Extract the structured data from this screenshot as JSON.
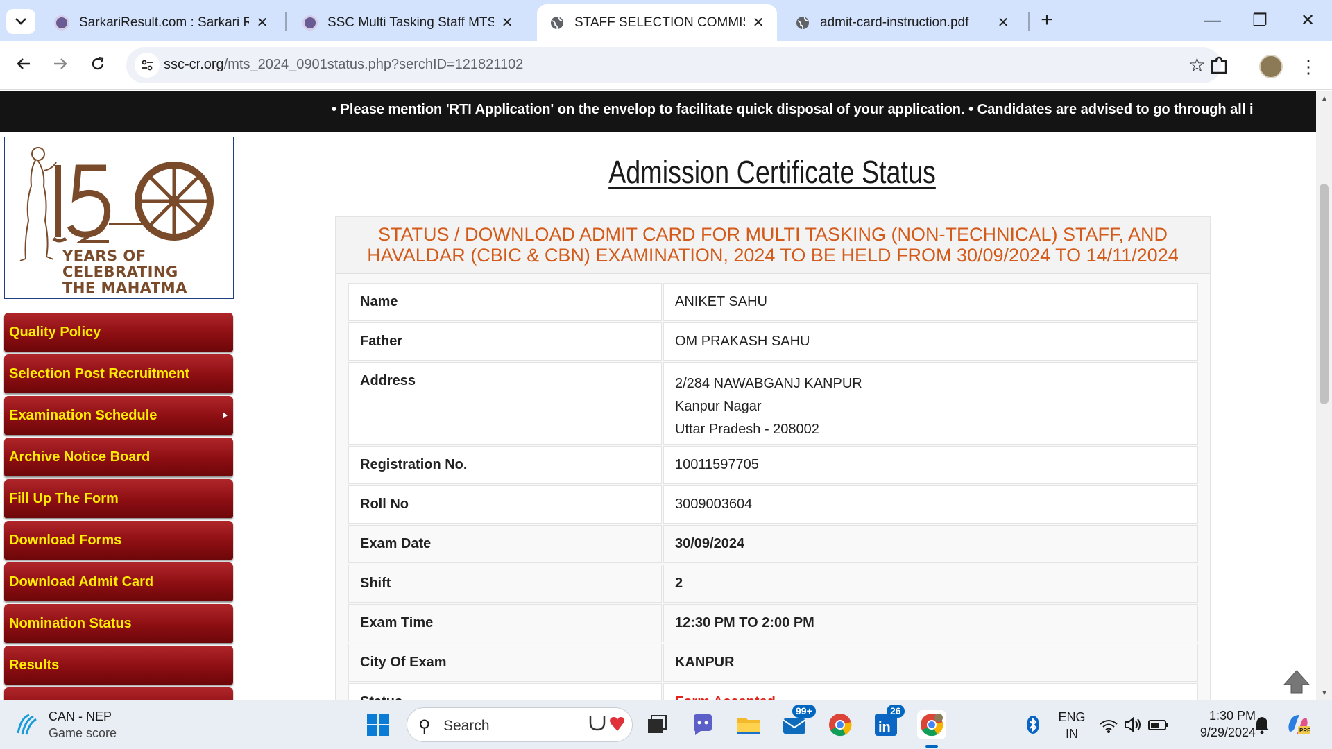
{
  "browser": {
    "tabs": [
      {
        "title": "SarkariResult.com : Sarkari Resu",
        "active": false
      },
      {
        "title": "SSC Multi Tasking Staff MTS Adi",
        "active": false
      },
      {
        "title": "STAFF SELECTION COMMISSION",
        "active": true
      },
      {
        "title": "admit-card-instruction.pdf",
        "active": false
      }
    ],
    "close_symbol": "✕",
    "new_tab_symbol": "+",
    "window_controls": {
      "minimize": "—",
      "restore": "❐",
      "close": "✕"
    },
    "url_host": "ssc-cr.org",
    "url_path": "/mts_2024_0901status.php?serchID=121821102"
  },
  "page": {
    "marquee": "• Please mention 'RTI Application' on the envelop to facilitate quick disposal of your application.  • Candidates are advised to go through all i",
    "logo": {
      "number": "150",
      "tagline_lines": [
        "YEARS OF",
        "CELEBRATING",
        "THE MAHATMA"
      ]
    },
    "menu": [
      "Quality Policy",
      "Selection Post Recruitment",
      "Examination Schedule",
      "Archive Notice Board",
      "Fill Up The Form",
      "Download Forms",
      "Download Admit Card",
      "Nomination Status",
      "Results"
    ],
    "title": "Admission Certificate Status",
    "heading": "STATUS / DOWNLOAD ADMIT CARD FOR MULTI TASKING (NON-TECHNICAL) STAFF, AND HAVALDAR (CBIC & CBN) EXAMINATION, 2024 TO BE HELD FROM 30/09/2024 TO 14/11/2024",
    "rows": [
      {
        "label": "Name",
        "value": "ANIKET SAHU"
      },
      {
        "label": "Father",
        "value": "OM PRAKASH SAHU"
      },
      {
        "label": "Address",
        "lines": [
          "2/284 NAWABGANJ KANPUR",
          "Kanpur Nagar",
          "Uttar Pradesh - 208002"
        ]
      },
      {
        "label": "Registration No.",
        "value": "10011597705"
      },
      {
        "label": "Roll No",
        "value": "3009003604"
      },
      {
        "label": "Exam Date",
        "value": "30/09/2024"
      },
      {
        "label": "Shift",
        "value": "2"
      },
      {
        "label": "Exam Time",
        "value": "12:30 PM TO 2:00 PM"
      },
      {
        "label": "City Of Exam",
        "value": "KANPUR"
      },
      {
        "label": "Status",
        "value": "Form Accepted"
      }
    ]
  },
  "taskbar": {
    "weather_title": "CAN - NEP",
    "weather_sub": "Game score",
    "search_placeholder": "Search",
    "mail_badge": "99+",
    "linkedin_badge": "26",
    "lang_top": "ENG",
    "lang_bottom": "IN",
    "time": "1:30 PM",
    "date": "9/29/2024"
  },
  "colors": {
    "menu_text": "#ffec00",
    "menu_bg": "#8c0e12",
    "heading_text": "#d35a18",
    "status_text": "#e2241a",
    "tabstrip": "#d3e3fd"
  }
}
